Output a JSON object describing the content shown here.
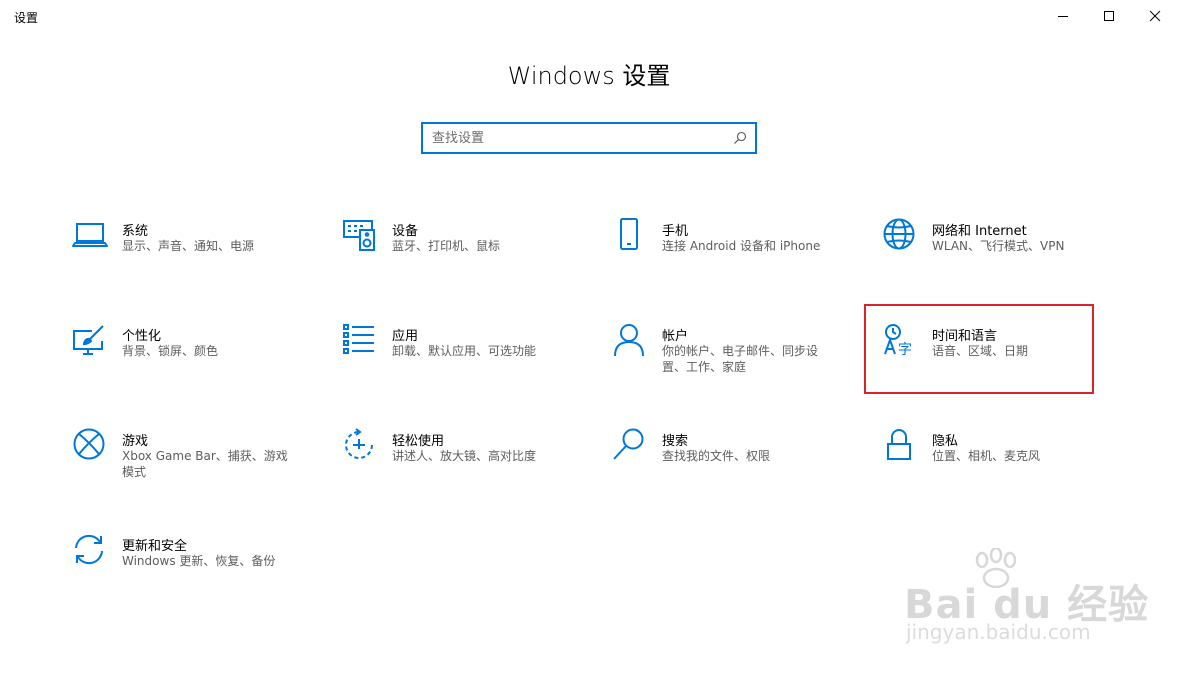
{
  "window": {
    "title": "设置",
    "controls": [
      "minimize-icon",
      "maximize-icon",
      "close-icon"
    ]
  },
  "page": {
    "title": "Windows 设置"
  },
  "search": {
    "placeholder": "查找设置",
    "value": ""
  },
  "colors": {
    "accent": "#0078d7",
    "highlight": "#d9242b",
    "description": "#5d5d5d"
  },
  "tiles": [
    {
      "title": "系统",
      "desc": "显示、声音、通知、电源",
      "icon": "laptop-icon"
    },
    {
      "title": "设备",
      "desc": "蓝牙、打印机、鼠标",
      "icon": "keyboard-speaker-icon"
    },
    {
      "title": "手机",
      "desc": "连接 Android 设备和 iPhone",
      "icon": "phone-icon"
    },
    {
      "title": "网络和 Internet",
      "desc": "WLAN、飞行模式、VPN",
      "icon": "globe-icon"
    },
    {
      "title": "个性化",
      "desc": "背景、锁屏、颜色",
      "icon": "paint-monitor-icon"
    },
    {
      "title": "应用",
      "desc": "卸载、默认应用、可选功能",
      "icon": "app-list-icon"
    },
    {
      "title": "帐户",
      "desc": "你的帐户、电子邮件、同步设置、工作、家庭",
      "icon": "person-icon"
    },
    {
      "title": "时间和语言",
      "desc": "语音、区域、日期",
      "icon": "time-language-icon"
    },
    {
      "title": "游戏",
      "desc": "Xbox Game Bar、捕获、游戏模式",
      "icon": "xbox-icon"
    },
    {
      "title": "轻松使用",
      "desc": "讲述人、放大镜、高对比度",
      "icon": "ease-of-access-icon"
    },
    {
      "title": "搜索",
      "desc": "查找我的文件、权限",
      "icon": "magnifier-icon"
    },
    {
      "title": "隐私",
      "desc": "位置、相机、麦克风",
      "icon": "lock-icon"
    },
    {
      "title": "更新和安全",
      "desc": "Windows 更新、恢复、备份",
      "icon": "sync-arrows-icon"
    }
  ],
  "watermark": {
    "logo": "Bai du 经验",
    "url": "jingyan.baidu.com"
  }
}
